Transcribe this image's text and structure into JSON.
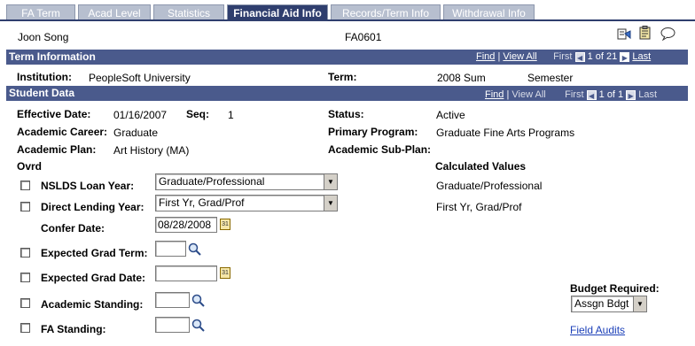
{
  "tabs": [
    "FA Term",
    "Acad Level",
    "Statistics",
    "Financial Aid Info",
    "Records/Term Info",
    "Withdrawal Info"
  ],
  "header": {
    "student_name": "Joon Song",
    "student_id": "FA0601"
  },
  "term_info": {
    "title": "Term Information",
    "nav": {
      "find": "Find",
      "view_all": "View All",
      "first": "First",
      "count": "1 of 21",
      "last": "Last"
    },
    "institution_label": "Institution:",
    "institution_value": "PeopleSoft University",
    "term_label": "Term:",
    "term_value": "2008 Sum",
    "term_type": "Semester"
  },
  "student_data": {
    "title": "Student Data",
    "nav": {
      "find": "Find",
      "view_all": "View All",
      "first": "First",
      "count": "1 of 1",
      "last": "Last"
    },
    "effective_date_label": "Effective Date:",
    "effective_date_value": "01/16/2007",
    "seq_label": "Seq:",
    "seq_value": "1",
    "status_label": "Status:",
    "status_value": "Active",
    "career_label": "Academic Career:",
    "career_value": "Graduate",
    "program_label": "Primary Program:",
    "program_value": "Graduate Fine Arts Programs",
    "plan_label": "Academic Plan:",
    "plan_value": "Art History (MA)",
    "subplan_label": "Academic Sub-Plan:",
    "ovrd_label": "Ovrd",
    "calc_label": "Calculated Values",
    "nslds_label": "NSLDS Loan Year:",
    "nslds_value": "Graduate/Professional",
    "nslds_calc": "Graduate/Professional",
    "dl_label": "Direct Lending Year:",
    "dl_value": "First Yr, Grad/Prof",
    "dl_calc": "First Yr, Grad/Prof",
    "confer_label": "Confer Date:",
    "confer_value": "08/28/2008",
    "exp_grad_term_label": "Expected Grad Term:",
    "exp_grad_date_label": "Expected Grad Date:",
    "acad_standing_label": "Academic Standing:",
    "fa_standing_label": "FA Standing:",
    "budget_label": "Budget Required:",
    "budget_value": "Assgn Bdgt",
    "field_audits": "Field Audits"
  }
}
